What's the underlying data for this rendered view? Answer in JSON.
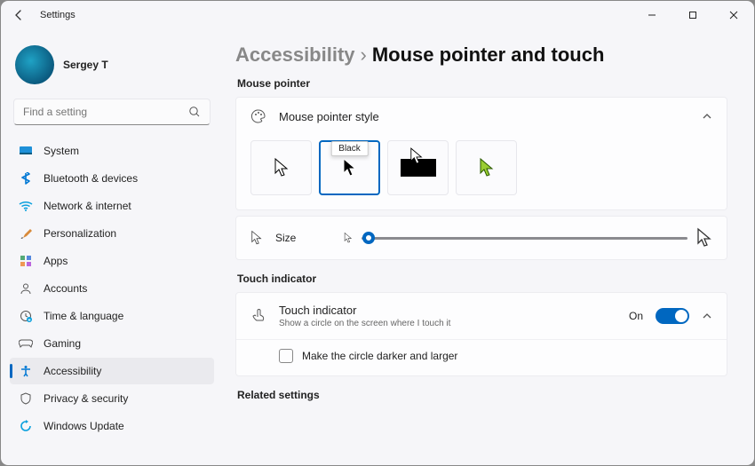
{
  "window": {
    "title": "Settings"
  },
  "user": {
    "name": "Sergey T"
  },
  "search": {
    "placeholder": "Find a setting"
  },
  "nav": {
    "items": [
      {
        "label": "System"
      },
      {
        "label": "Bluetooth & devices"
      },
      {
        "label": "Network & internet"
      },
      {
        "label": "Personalization"
      },
      {
        "label": "Apps"
      },
      {
        "label": "Accounts"
      },
      {
        "label": "Time & language"
      },
      {
        "label": "Gaming"
      },
      {
        "label": "Accessibility"
      },
      {
        "label": "Privacy & security"
      },
      {
        "label": "Windows Update"
      }
    ]
  },
  "breadcrumb": {
    "part1": "Accessibility",
    "part2": "Mouse pointer and touch"
  },
  "sections": {
    "mouse_pointer": "Mouse pointer",
    "touch_indicator": "Touch indicator",
    "related": "Related settings"
  },
  "style_row": {
    "label": "Mouse pointer style"
  },
  "style_options": {
    "selected_tooltip": "Black"
  },
  "size_row": {
    "label": "Size"
  },
  "touch": {
    "title": "Touch indicator",
    "sub": "Show a circle on the screen where I touch it",
    "state": "On",
    "option": "Make the circle darker and larger"
  }
}
